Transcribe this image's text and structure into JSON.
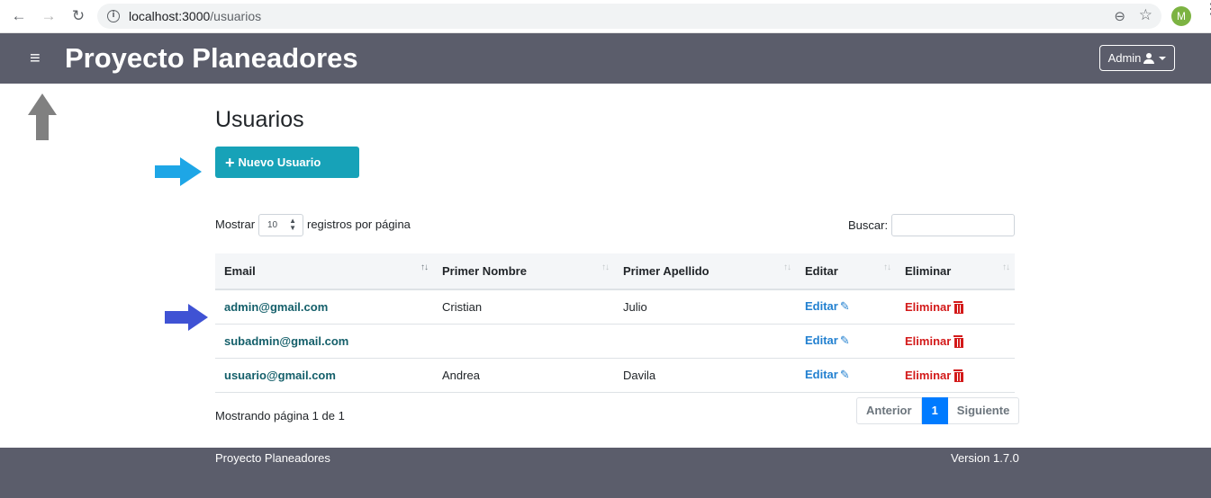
{
  "browser": {
    "url_host": "localhost:3000",
    "url_path": "/usuarios",
    "profile_initial": "M",
    "back_icon": "←",
    "forward_icon": "→",
    "reload_icon": "↻",
    "info_icon": "i",
    "zoom_icon": "⊖",
    "star_icon": "☆",
    "menu_icon": "⋮"
  },
  "navbar": {
    "menu_icon": "≡",
    "brand": "Proyecto Planeadores",
    "user_menu_label": "Admin"
  },
  "main": {
    "title": "Usuarios",
    "new_user_label": "Nuevo Usuario",
    "show_label": "Mostrar",
    "page_size": "10",
    "per_page_label": "registros por página",
    "search_label": "Buscar:",
    "search_value": "",
    "table": {
      "headers": [
        "Email",
        "Primer Nombre",
        "Primer Apellido",
        "Editar",
        "Eliminar"
      ],
      "rows": [
        {
          "email": "admin@gmail.com",
          "first_name": "Cristian",
          "last_name": "Julio",
          "edit": "Editar",
          "delete": "Eliminar"
        },
        {
          "email": "subadmin@gmail.com",
          "first_name": "",
          "last_name": "",
          "edit": "Editar",
          "delete": "Eliminar"
        },
        {
          "email": "usuario@gmail.com",
          "first_name": "Andrea",
          "last_name": "Davila",
          "edit": "Editar",
          "delete": "Eliminar"
        }
      ]
    },
    "page_info": "Mostrando página 1 de 1",
    "pagination": {
      "prev": "Anterior",
      "current": "1",
      "next": "Siguiente"
    }
  },
  "footer": {
    "left": "Proyecto Planeadores",
    "right": "Version 1.7.0"
  },
  "colors": {
    "navbar_bg": "#5b5d6b",
    "primary_button": "#17a2b8",
    "email_link": "#145f6a",
    "edit_link": "#2280d0",
    "delete_link": "#d31a1a",
    "pagination_active": "#007bff",
    "arrow_gray": "#808080",
    "arrow_cyan": "#1ea6e6",
    "arrow_blue": "#3f52d4"
  }
}
